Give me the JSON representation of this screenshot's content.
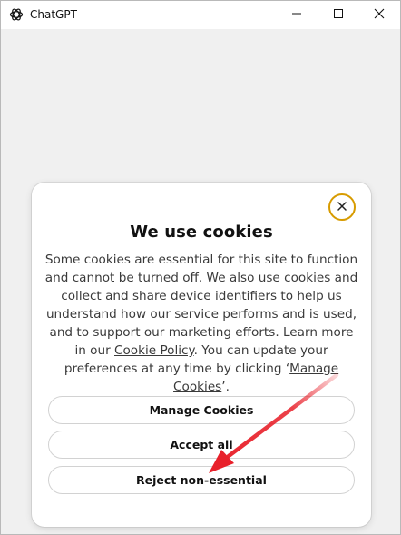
{
  "window": {
    "title": "ChatGPT",
    "icons": {
      "app": "chatgpt-logo-icon",
      "minimize": "minimize-icon",
      "maximize": "maximize-icon",
      "close": "close-icon"
    }
  },
  "dialog": {
    "title": "We use cookies",
    "body_part1": "Some cookies are essential for this site to function and cannot be turned off. We also use cookies and collect and share device identifiers to help us understand how our service performs and is used, and to support our marketing efforts. Learn more in our ",
    "cookie_policy_link": "Cookie Policy",
    "body_part2": ". You can update your preferences at any time by clicking ‘",
    "manage_cookies_link": "Manage Cookies",
    "body_part3": "’.",
    "close_icon": "close-x-icon",
    "buttons": {
      "manage": "Manage Cookies",
      "accept": "Accept all",
      "reject": "Reject non-essential"
    }
  },
  "annotation": {
    "arrow_color": "#e8202a",
    "points_to": "Reject non-essential"
  },
  "colors": {
    "close_ring": "#d79b00",
    "window_bg": "#f0f0f0"
  }
}
